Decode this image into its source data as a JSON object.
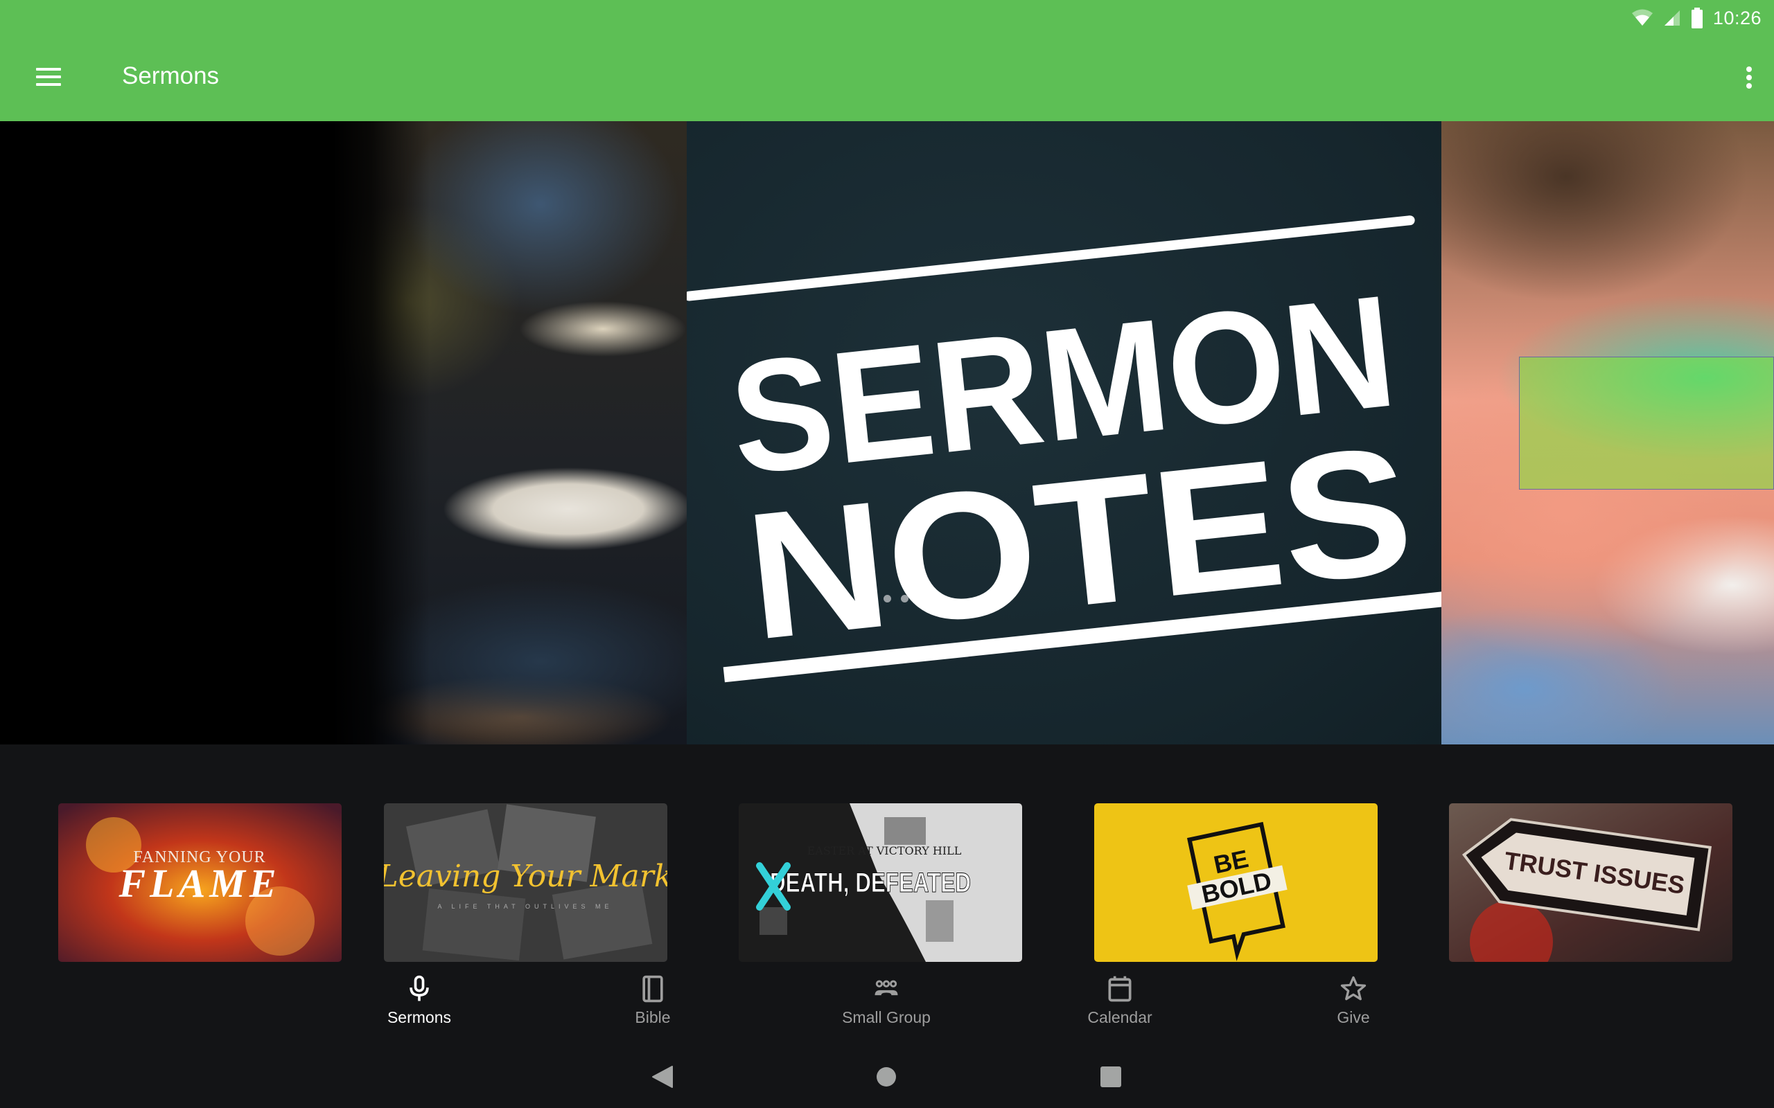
{
  "status_bar": {
    "time": "10:26",
    "icons": [
      "wifi-icon",
      "cell-signal-icon",
      "battery-icon"
    ]
  },
  "app_bar": {
    "title": "Sermons",
    "menu_icon": "hamburger-menu-icon",
    "overflow_icon": "more-vert-icon",
    "color": "#5dbf55"
  },
  "hero": {
    "slides": [
      {
        "name": "congregation-notes-photo"
      },
      {
        "name": "sermon-notes-graphic",
        "line1": "SERMON",
        "line2": "NOTES"
      },
      {
        "name": "volunteer-photo"
      }
    ],
    "active_index": 0,
    "slide_count": 3
  },
  "series": [
    {
      "title": "Fanning Your Flame",
      "art_line1": "FANNING YOUR",
      "art_line2": "FLAME"
    },
    {
      "title": "Leaving Your Mark",
      "art_line1": "Leaving Your Mark",
      "art_line2": "A LIFE THAT OUTLIVES ME"
    },
    {
      "title": "Death, Defeated",
      "art_line1": "DEATH, DEFEATED",
      "art_line2": "EASTER AT VICTORY HILL"
    },
    {
      "title": "Be Bold",
      "art_line1": "BE",
      "art_line2": "BOLD"
    },
    {
      "title": "Trust Issues",
      "art_line1": "TRUST ISSUES"
    }
  ],
  "bottom_nav": {
    "items": [
      {
        "label": "Sermons",
        "icon": "microphone-icon",
        "active": true
      },
      {
        "label": "Bible",
        "icon": "book-icon",
        "active": false
      },
      {
        "label": "Small Group",
        "icon": "group-icon",
        "active": false
      },
      {
        "label": "Calendar",
        "icon": "calendar-icon",
        "active": false
      },
      {
        "label": "Give",
        "icon": "star-icon",
        "active": false
      }
    ]
  },
  "system_nav": {
    "buttons": [
      "back",
      "home",
      "recents"
    ]
  }
}
